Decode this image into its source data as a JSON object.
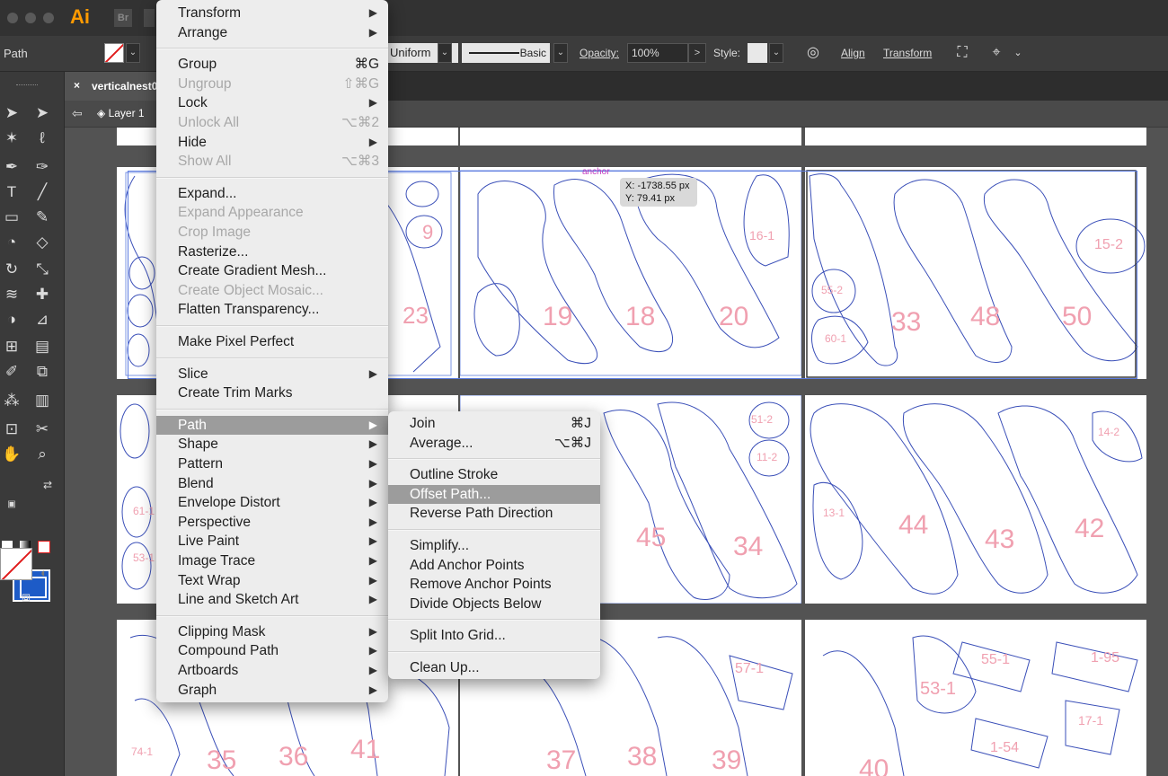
{
  "app": {
    "logo": "Ai",
    "bridge_logo": "Br"
  },
  "control_bar": {
    "selection_type": "Path",
    "profile": "Uniform",
    "brush": "Basic",
    "opacity_label": "Opacity:",
    "opacity_value": "100%",
    "opacity_arrow": ">",
    "style_label": "Style:",
    "align_label": "Align",
    "transform_label": "Transform"
  },
  "document": {
    "tab_title": "verticalnest0",
    "close": "×",
    "layer": "Layer 1"
  },
  "object_menu": {
    "items": [
      {
        "label": "Transform",
        "shortcut": "",
        "submenu": true,
        "disabled": false
      },
      {
        "label": "Arrange",
        "shortcut": "",
        "submenu": true,
        "disabled": false
      },
      {
        "sep": true
      },
      {
        "label": "Group",
        "shortcut": "⌘G",
        "submenu": false,
        "disabled": false
      },
      {
        "label": "Ungroup",
        "shortcut": "⇧⌘G",
        "submenu": false,
        "disabled": true
      },
      {
        "label": "Lock",
        "shortcut": "",
        "submenu": true,
        "disabled": false
      },
      {
        "label": "Unlock All",
        "shortcut": "⌥⌘2",
        "submenu": false,
        "disabled": true
      },
      {
        "label": "Hide",
        "shortcut": "",
        "submenu": true,
        "disabled": false
      },
      {
        "label": "Show All",
        "shortcut": "⌥⌘3",
        "submenu": false,
        "disabled": true
      },
      {
        "sep": true
      },
      {
        "label": "Expand...",
        "shortcut": "",
        "submenu": false,
        "disabled": false
      },
      {
        "label": "Expand Appearance",
        "shortcut": "",
        "submenu": false,
        "disabled": true
      },
      {
        "label": "Crop Image",
        "shortcut": "",
        "submenu": false,
        "disabled": true
      },
      {
        "label": "Rasterize...",
        "shortcut": "",
        "submenu": false,
        "disabled": false
      },
      {
        "label": "Create Gradient Mesh...",
        "shortcut": "",
        "submenu": false,
        "disabled": false
      },
      {
        "label": "Create Object Mosaic...",
        "shortcut": "",
        "submenu": false,
        "disabled": true
      },
      {
        "label": "Flatten Transparency...",
        "shortcut": "",
        "submenu": false,
        "disabled": false
      },
      {
        "sep": true
      },
      {
        "label": "Make Pixel Perfect",
        "shortcut": "",
        "submenu": false,
        "disabled": false
      },
      {
        "sep": true
      },
      {
        "label": "Slice",
        "shortcut": "",
        "submenu": true,
        "disabled": false
      },
      {
        "label": "Create Trim Marks",
        "shortcut": "",
        "submenu": false,
        "disabled": false
      },
      {
        "sep": true
      },
      {
        "label": "Path",
        "shortcut": "",
        "submenu": true,
        "disabled": false,
        "highlighted": true
      },
      {
        "label": "Shape",
        "shortcut": "",
        "submenu": true,
        "disabled": false
      },
      {
        "label": "Pattern",
        "shortcut": "",
        "submenu": true,
        "disabled": false
      },
      {
        "label": "Blend",
        "shortcut": "",
        "submenu": true,
        "disabled": false
      },
      {
        "label": "Envelope Distort",
        "shortcut": "",
        "submenu": true,
        "disabled": false
      },
      {
        "label": "Perspective",
        "shortcut": "",
        "submenu": true,
        "disabled": false
      },
      {
        "label": "Live Paint",
        "shortcut": "",
        "submenu": true,
        "disabled": false
      },
      {
        "label": "Image Trace",
        "shortcut": "",
        "submenu": true,
        "disabled": false
      },
      {
        "label": "Text Wrap",
        "shortcut": "",
        "submenu": true,
        "disabled": false
      },
      {
        "label": "Line and Sketch Art",
        "shortcut": "",
        "submenu": true,
        "disabled": false
      },
      {
        "sep": true
      },
      {
        "label": "Clipping Mask",
        "shortcut": "",
        "submenu": true,
        "disabled": false
      },
      {
        "label": "Compound Path",
        "shortcut": "",
        "submenu": true,
        "disabled": false
      },
      {
        "label": "Artboards",
        "shortcut": "",
        "submenu": true,
        "disabled": false
      },
      {
        "label": "Graph",
        "shortcut": "",
        "submenu": true,
        "disabled": false
      }
    ]
  },
  "path_submenu": {
    "items": [
      {
        "label": "Join",
        "shortcut": "⌘J"
      },
      {
        "label": "Average...",
        "shortcut": "⌥⌘J"
      },
      {
        "sep": true
      },
      {
        "label": "Outline Stroke",
        "shortcut": ""
      },
      {
        "label": "Offset Path...",
        "shortcut": "",
        "highlighted": true
      },
      {
        "label": "Reverse Path Direction",
        "shortcut": ""
      },
      {
        "sep": true
      },
      {
        "label": "Simplify...",
        "shortcut": ""
      },
      {
        "label": "Add Anchor Points",
        "shortcut": ""
      },
      {
        "label": "Remove Anchor Points",
        "shortcut": ""
      },
      {
        "label": "Divide Objects Below",
        "shortcut": ""
      },
      {
        "sep": true
      },
      {
        "label": "Split Into Grid...",
        "shortcut": ""
      },
      {
        "sep": true
      },
      {
        "label": "Clean Up...",
        "shortcut": ""
      }
    ]
  },
  "canvas": {
    "tooltip_x": "X: -1738.55 px",
    "tooltip_y": "Y: 79.41 px",
    "anchor_label": "anchor",
    "artboards": [
      {
        "labels": [
          "19",
          "18",
          "20",
          "16-1"
        ]
      },
      {
        "labels": [
          "33",
          "48",
          "50",
          "55-2",
          "15-2",
          "60-1"
        ]
      },
      {
        "labels": [
          "45",
          "34",
          "51-2",
          "11-2"
        ]
      },
      {
        "labels": [
          "44",
          "43",
          "42",
          "13-1",
          "14-2"
        ]
      },
      {
        "labels": [
          "37",
          "38",
          "39",
          "57-1"
        ]
      },
      {
        "labels": [
          "40",
          "53-1",
          "55-1",
          "1-95",
          "17-1",
          "1-54"
        ]
      },
      {
        "labels": [
          "35",
          "36",
          "41",
          "74-1"
        ]
      },
      {
        "labels": [
          "61-1",
          "53-1",
          "9",
          "23"
        ]
      }
    ]
  },
  "colors": {
    "accent_blue": "#1d5bc7",
    "outline": "#3a4fb8",
    "label_pink": "#f0a0b0",
    "menu_highlight": "#9c9c9c"
  }
}
